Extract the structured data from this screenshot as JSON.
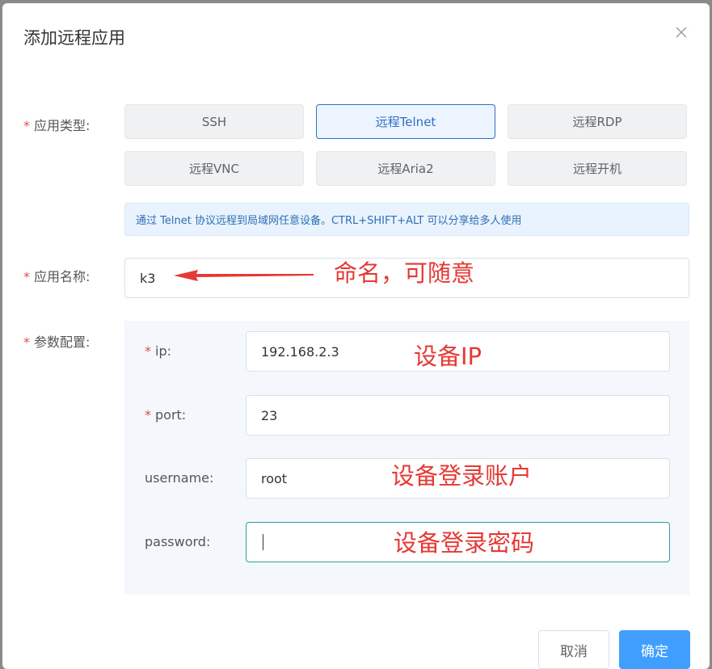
{
  "dialog": {
    "title": "添加远程应用",
    "close_icon": "close-icon"
  },
  "form": {
    "app_type": {
      "required_mark": "*",
      "label": "应用类型:",
      "options": [
        "SSH",
        "远程Telnet",
        "远程RDP",
        "远程VNC",
        "远程Aria2",
        "远程开机"
      ],
      "selected": "远程Telnet"
    },
    "hint": "通过 Telnet 协议远程到局域网任意设备。CTRL+SHIFT+ALT 可以分享给多人使用",
    "app_name": {
      "required_mark": "*",
      "label": "应用名称:",
      "value": "k3"
    },
    "params": {
      "required_mark": "*",
      "label": "参数配置:",
      "ip": {
        "required_mark": "*",
        "label": "ip:",
        "value": "192.168.2.3"
      },
      "port": {
        "required_mark": "*",
        "label": "port:",
        "value": "23"
      },
      "username": {
        "label": "username:",
        "value": "root"
      },
      "password": {
        "label": "password:",
        "value": ""
      }
    }
  },
  "annotations": {
    "name": "命名，可随意",
    "ip": "设备IP",
    "account": "设备登录账户",
    "password": "设备登录密码"
  },
  "footer": {
    "cancel": "取消",
    "confirm": "确定"
  },
  "colors": {
    "primary": "#409eff",
    "selected_border": "#2e6fc4",
    "required": "#e34d4d",
    "annotation": "#e53935"
  }
}
